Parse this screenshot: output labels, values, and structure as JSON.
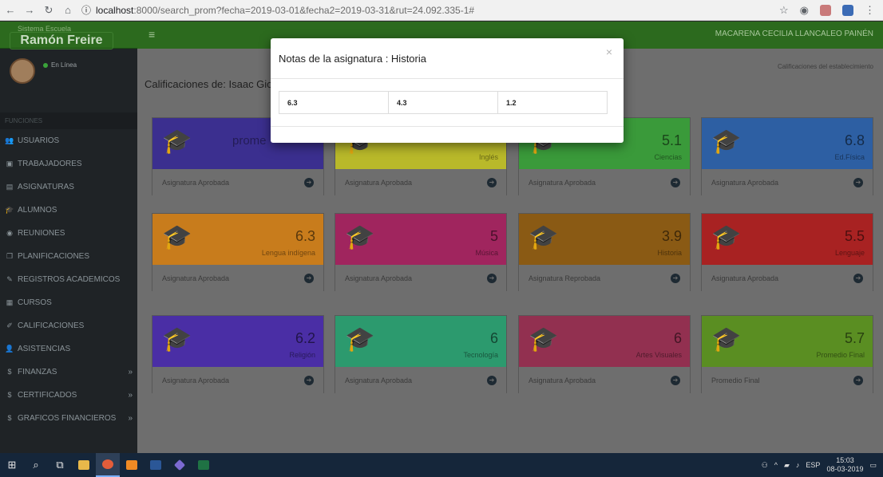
{
  "browser": {
    "url_host": "localhost",
    "url_path": ":8000/search_prom?fecha=2019-03-01&fecha2=2019-03-31&rut=24.092.335-1#"
  },
  "sidebar": {
    "logo_sub": "Sistema Escuela",
    "logo_name": "Ramón Freire",
    "status": "En Línea",
    "section": "FUNCIONES",
    "items": [
      {
        "label": "USUARIOS",
        "icon": "users-icon"
      },
      {
        "label": "TRABAJADORES",
        "icon": "id-card-icon"
      },
      {
        "label": "ASIGNATURAS",
        "icon": "book-icon"
      },
      {
        "label": "ALUMNOS",
        "icon": "graduation-cap-icon"
      },
      {
        "label": "REUNIONES",
        "icon": "group-icon"
      },
      {
        "label": "PLANIFICACIONES",
        "icon": "copy-icon"
      },
      {
        "label": "REGISTROS ACADEMICOS",
        "icon": "pencil-icon"
      },
      {
        "label": "CURSOS",
        "icon": "building-icon"
      },
      {
        "label": "CALIFICACIONES",
        "icon": "edit-icon"
      },
      {
        "label": "ASISTENCIAS",
        "icon": "user-edit-icon"
      },
      {
        "label": "FINANZAS",
        "icon": "dollar-icon"
      },
      {
        "label": "CERTIFICADOS",
        "icon": "dollar-icon"
      },
      {
        "label": "GRAFICOS FINANCIEROS",
        "icon": "dollar-icon"
      }
    ]
  },
  "topbar": {
    "user_name": "MACARENA CECILIA LLANCALEO PAINÉN"
  },
  "content": {
    "heading": "Calificaciones de: Isaac Gio",
    "breadcrumb": "Calificaciones del establecimiento",
    "cards": [
      {
        "value": "",
        "subject": "",
        "status": "Asignatura Aprobada",
        "color": "#3b2f8f",
        "partial": "prome"
      },
      {
        "value": "",
        "subject": "Inglés",
        "status": "Asignatura Aprobada",
        "color": "#b9b92a"
      },
      {
        "value": "5.1",
        "subject": "Ciencias",
        "status": "Asignatura Aprobada",
        "color": "#3a9a3a"
      },
      {
        "value": "6.8",
        "subject": "Ed.Física",
        "status": "Asignatura Aprobada",
        "color": "#2d5fa3"
      },
      {
        "value": "6.3",
        "subject": "Lengua indígena",
        "status": "Asignatura Aprobada",
        "color": "#c87c1c"
      },
      {
        "value": "5",
        "subject": "Música",
        "status": "Asignatura Aprobada",
        "color": "#a0255e"
      },
      {
        "value": "3.9",
        "subject": "Historia",
        "status": "Asignatura Reprobada",
        "color": "#8a5a14"
      },
      {
        "value": "5.5",
        "subject": "Lenguaje",
        "status": "Asignatura Aprobada",
        "color": "#a82222"
      },
      {
        "value": "6.2",
        "subject": "Religión",
        "status": "Asignatura Aprobada",
        "color": "#4a2ea5"
      },
      {
        "value": "6",
        "subject": "Tecnología",
        "status": "Asignatura Aprobada",
        "color": "#2c9a6e"
      },
      {
        "value": "6",
        "subject": "Artes Visuales",
        "status": "Asignatura Aprobada",
        "color": "#923050"
      },
      {
        "value": "5.7",
        "subject": "Promedio Final",
        "status": "Promedio Final",
        "color": "#5a8e22"
      }
    ]
  },
  "modal": {
    "title": "Notas de la asignatura : Historia",
    "close": "×",
    "grades": [
      "6.3",
      "4.3",
      "1.2"
    ]
  },
  "taskbar": {
    "lang": "ESP",
    "time": "15:03",
    "date": "08-03-2019"
  }
}
